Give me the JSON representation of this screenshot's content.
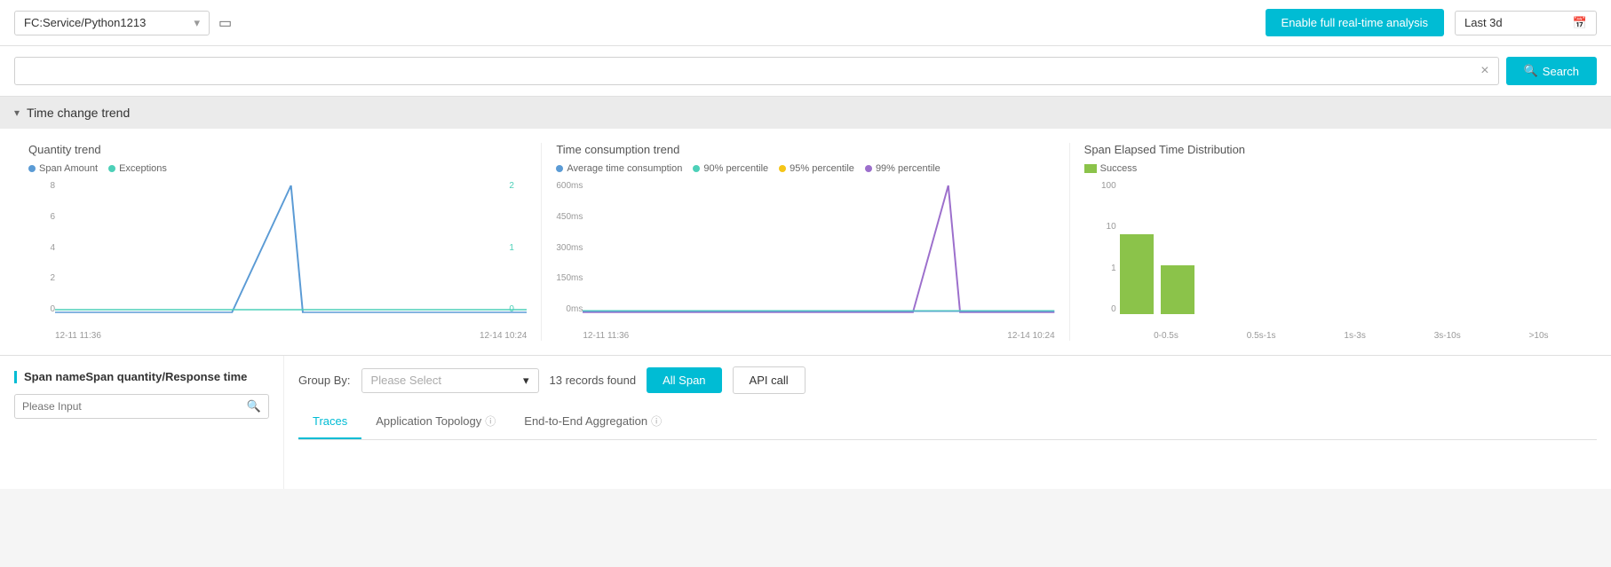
{
  "topbar": {
    "service": "FC:Service/Python1213",
    "enable_btn": "Enable full real-time analysis",
    "date_range": "Last 3d"
  },
  "search": {
    "placeholder": "",
    "clear_label": "×",
    "btn_label": "Search"
  },
  "time_section": {
    "title": "Time change trend",
    "collapsed": false
  },
  "quantity_chart": {
    "title": "Quantity trend",
    "legend": [
      {
        "label": "Span Amount",
        "color": "#5b9bd5"
      },
      {
        "label": "Exceptions",
        "color": "#4dd0b8"
      }
    ],
    "y_labels": [
      "8",
      "6",
      "4",
      "2",
      "0"
    ],
    "y_labels_right": [
      "2",
      "1",
      "0"
    ],
    "x_labels": [
      "12-11 11:36",
      "12-14 10:24"
    ]
  },
  "time_consumption_chart": {
    "title": "Time consumption trend",
    "legend": [
      {
        "label": "Average time consumption",
        "color": "#5b9bd5"
      },
      {
        "label": "90% percentile",
        "color": "#4dd0b8"
      },
      {
        "label": "95% percentile",
        "color": "#f5c518"
      },
      {
        "label": "99% percentile",
        "color": "#9c6fcc"
      }
    ],
    "y_labels": [
      "600ms",
      "450ms",
      "300ms",
      "150ms",
      "0ms"
    ],
    "x_labels": [
      "12-11 11:36",
      "12-14 10:24"
    ]
  },
  "elapsed_chart": {
    "title": "Span Elapsed Time Distribution",
    "legend": [
      {
        "label": "Success",
        "color": "#8bc34a"
      }
    ],
    "y_labels": [
      "100",
      "10",
      "1",
      "0"
    ],
    "bars": [
      {
        "label": "0-0.5s",
        "height_pct": 85,
        "value": 10
      },
      {
        "label": "0.5s-1s",
        "height_pct": 60,
        "value": 1
      },
      {
        "label": "1s-3s",
        "height_pct": 0,
        "value": 0
      },
      {
        "label": "3s-10s",
        "height_pct": 0,
        "value": 0
      },
      {
        "label": ">10s",
        "height_pct": 0,
        "value": 0
      }
    ]
  },
  "bottom": {
    "left_title": "Span name",
    "left_title2": "Span quantity",
    "left_divider": "/",
    "left_title3": " Response time",
    "input_placeholder": "Please Input",
    "group_by_label": "Group By:",
    "group_select_placeholder": "Please Select",
    "records_found": "13 records found",
    "all_span_btn": "All Span",
    "api_call_btn": "API call",
    "tabs": [
      {
        "label": "Traces",
        "active": true,
        "has_help": false
      },
      {
        "label": "Application Topology",
        "active": false,
        "has_help": true
      },
      {
        "label": "End-to-End Aggregation",
        "active": false,
        "has_help": true
      }
    ]
  }
}
